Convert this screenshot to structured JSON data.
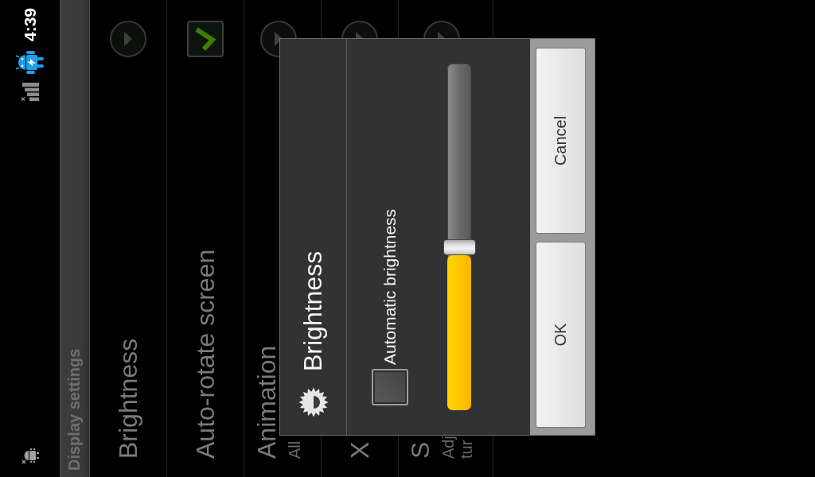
{
  "status_bar": {
    "time": "4:39"
  },
  "title_bar": {
    "title": "Display settings"
  },
  "settings_list": [
    {
      "kind": "arrow",
      "title": "Brightness"
    },
    {
      "kind": "checkbox",
      "title": "Auto-rotate screen",
      "checked": true
    },
    {
      "kind": "arrow",
      "title": "Animation",
      "summary": [
        "All"
      ]
    },
    {
      "kind": "arrow",
      "title": "X"
    },
    {
      "kind": "arrow",
      "title": "S",
      "summary": [
        "Adj",
        "tur"
      ]
    }
  ],
  "dialog": {
    "title": "Brightness",
    "auto_brightness": {
      "label": "Automatic brightness",
      "checked": false
    },
    "slider": {
      "level": 0.47
    },
    "buttons": [
      {
        "label": "OK"
      },
      {
        "label": "Cancel"
      }
    ]
  }
}
